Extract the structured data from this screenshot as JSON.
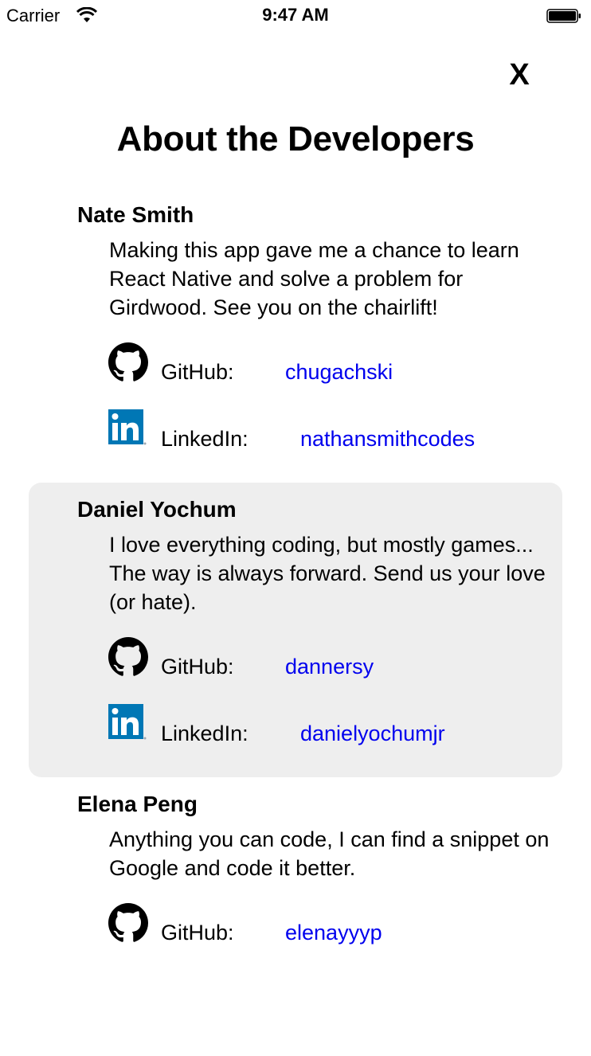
{
  "status_bar": {
    "carrier": "Carrier",
    "time": "9:47 AM"
  },
  "close_label": "X",
  "title": "About the Developers",
  "link_color": "#0000ee",
  "highlight_color": "#eeeeee",
  "developers": [
    {
      "name": "Nate Smith",
      "bio": "Making this app gave me a chance to learn React Native and solve a problem for Girdwood. See you on the chairlift!",
      "github_label": "GitHub:",
      "github": "chugachski",
      "linkedin_label": "LinkedIn:",
      "linkedin": "nathansmithcodes"
    },
    {
      "name": "Daniel Yochum",
      "bio": "I love everything coding, but mostly games... The way is always forward. Send us your love (or hate).",
      "github_label": "GitHub:",
      "github": "dannersy",
      "linkedin_label": "LinkedIn:",
      "linkedin": "danielyochumjr"
    },
    {
      "name": "Elena Peng",
      "bio": "Anything you can code, I can find a snippet on Google and code it better.",
      "github_label": "GitHub:",
      "github": "elenayyyp"
    }
  ]
}
